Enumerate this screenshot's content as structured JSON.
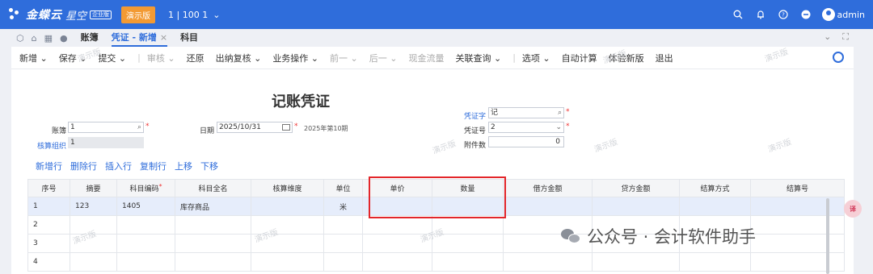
{
  "app": {
    "logo_text": "金蝶云",
    "logo_sub": "星空",
    "logo_badge": "企业版",
    "demo_badge": "演示版",
    "tenant": "1 | 100 1",
    "user": "admin"
  },
  "tabs": {
    "items": [
      {
        "label": "账簿"
      },
      {
        "label": "凭证 - 新增",
        "close": "×"
      },
      {
        "label": "科目"
      }
    ]
  },
  "toolbar": {
    "items": [
      "新增",
      "保存",
      "提交",
      "审核",
      "还原",
      "出纳复核",
      "业务操作",
      "前一",
      "后一",
      "现金流量",
      "关联查询",
      "选项",
      "自动计算",
      "体验新版",
      "退出"
    ]
  },
  "form": {
    "title": "记账凭证",
    "book_label": "账簿",
    "book_value": "1",
    "org_label": "核算组织",
    "org_value": "1",
    "date_label": "日期",
    "date_value": "2025/10/31",
    "period_note": "2025年第10期",
    "voucher_word_label": "凭证字",
    "voucher_word_value": "记",
    "voucher_no_label": "凭证号",
    "voucher_no_value": "2",
    "attach_label": "附件数",
    "attach_value": "0"
  },
  "row_actions": [
    "新增行",
    "删除行",
    "插入行",
    "复制行",
    "上移",
    "下移"
  ],
  "grid": {
    "headers": [
      "序号",
      "摘要",
      "科目编码",
      "科目全名",
      "核算维度",
      "单位",
      "单价",
      "数量",
      "借方金额",
      "贷方金额",
      "结算方式",
      "结算号"
    ],
    "rows": [
      [
        "1",
        "123",
        "1405",
        "库存商品",
        "",
        "米",
        "",
        "",
        "",
        "",
        "",
        ""
      ],
      [
        "2",
        "",
        "",
        "",
        "",
        "",
        "",
        "",
        "",
        "",
        "",
        ""
      ],
      [
        "3",
        "",
        "",
        "",
        "",
        "",
        "",
        "",
        "",
        "",
        "",
        ""
      ],
      [
        "4",
        "",
        "",
        "",
        "",
        "",
        "",
        "",
        "",
        "",
        "",
        ""
      ]
    ]
  },
  "watermark": "演示版",
  "side_badge": "译",
  "wechat": "公众号 · 会计软件助手"
}
